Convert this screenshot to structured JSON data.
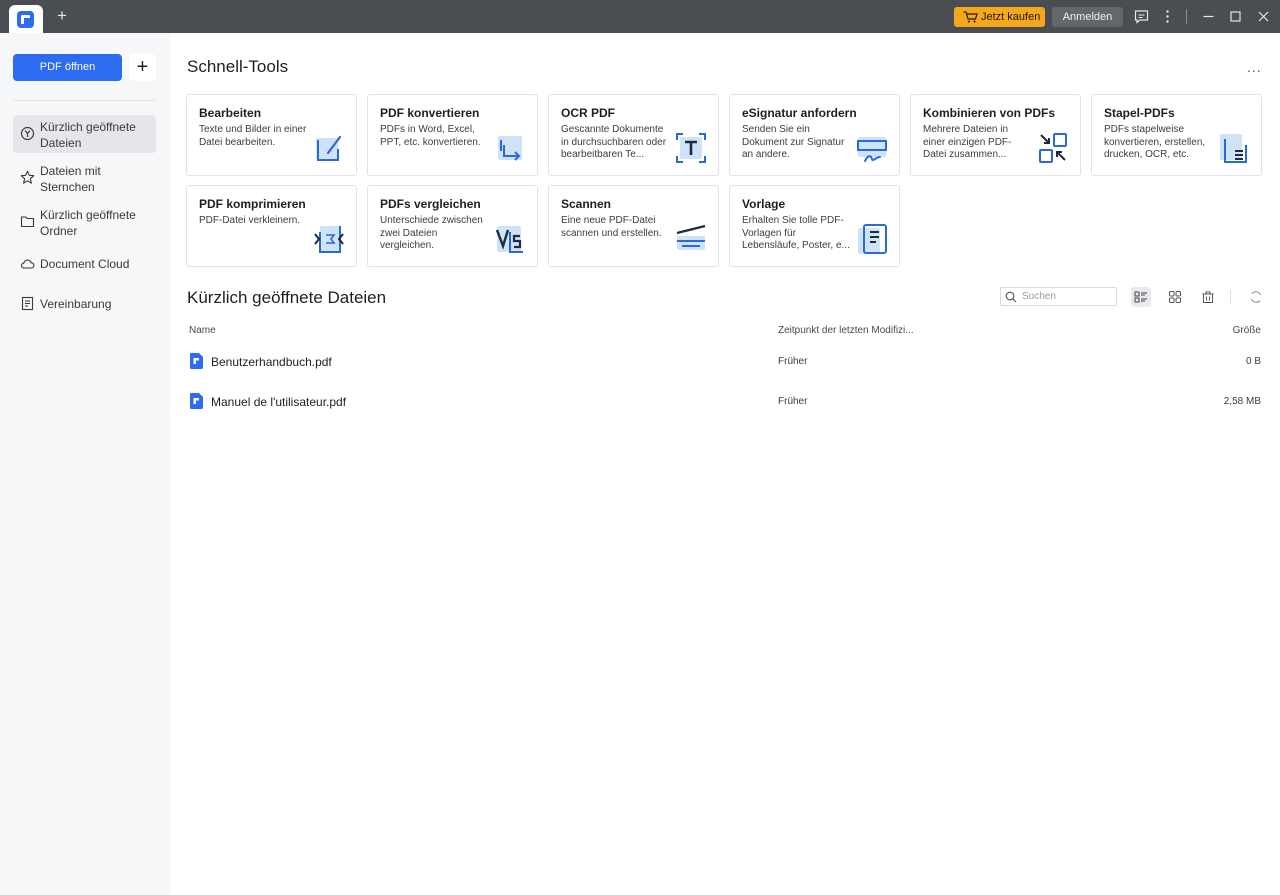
{
  "titlebar": {
    "buy_label": "Jetzt kaufen",
    "login_label": "Anmelden",
    "new_tab_symbol": "+"
  },
  "sidebar": {
    "open_pdf_label": "PDF öffnen",
    "add_symbol": "+",
    "items": [
      {
        "label": "Kürzlich geöffnete Dateien",
        "icon": "clock-icon",
        "active": true
      },
      {
        "label": "Dateien mit Sternchen",
        "icon": "star-icon",
        "active": false
      },
      {
        "label": "Kürzlich geöffnete Ordner",
        "icon": "folder-icon",
        "active": false
      },
      {
        "label": "Document Cloud",
        "icon": "cloud-icon",
        "active": false
      },
      {
        "label": "Vereinbarung",
        "icon": "document-icon",
        "active": false
      }
    ]
  },
  "quick_tools": {
    "title": "Schnell-Tools",
    "more": "...",
    "cards": [
      {
        "title": "Bearbeiten",
        "desc": "Texte und Bilder in einer Datei bearbeiten.",
        "icon": "edit-icon"
      },
      {
        "title": "PDF konvertieren",
        "desc": "PDFs in Word, Excel, PPT, etc. konvertieren.",
        "icon": "convert-icon"
      },
      {
        "title": "OCR PDF",
        "desc": "Gescannte Dokumente in durchsuchbaren oder bearbeitbaren Te...",
        "icon": "ocr-icon"
      },
      {
        "title": "eSignatur anfordern",
        "desc": "Senden Sie ein Dokument zur Signatur an andere.",
        "icon": "signature-icon"
      },
      {
        "title": "Kombinieren von PDFs",
        "desc": "Mehrere Dateien in einer einzigen PDF-Datei zusammen...",
        "icon": "combine-icon"
      },
      {
        "title": "Stapel-PDFs",
        "desc": "PDFs stapelweise konvertieren, erstellen, drucken, OCR, etc.",
        "icon": "batch-icon"
      },
      {
        "title": "PDF komprimieren",
        "desc": "PDF-Datei verkleinern.",
        "icon": "compress-icon"
      },
      {
        "title": "PDFs vergleichen",
        "desc": "Unterschiede zwischen zwei Dateien vergleichen.",
        "icon": "compare-icon"
      },
      {
        "title": "Scannen",
        "desc": "Eine neue PDF-Datei scannen und erstellen.",
        "icon": "scanner-icon"
      },
      {
        "title": "Vorlage",
        "desc": "Erhalten Sie tolle PDF-Vorlagen für Lebensläufe, Poster, e...",
        "icon": "template-icon"
      }
    ]
  },
  "recent": {
    "title": "Kürzlich geöffnete Dateien",
    "search_placeholder": "Suchen",
    "columns": {
      "name": "Name",
      "modified": "Zeitpunkt der letzten Modifizi...",
      "size": "Größe"
    },
    "files": [
      {
        "name": "Benutzerhandbuch.pdf",
        "modified": "Früher",
        "size": "0 B"
      },
      {
        "name": "Manuel de l'utilisateur.pdf",
        "modified": "Früher",
        "size": "2,58 MB"
      }
    ]
  },
  "colors": {
    "accent": "#2d6cf0",
    "buy": "#f7a71a",
    "titlebar": "#4a4d52",
    "sidebar": "#f6f7f9",
    "icon_light": "#cfe3f7",
    "icon_dark": "#2a6ad8"
  }
}
